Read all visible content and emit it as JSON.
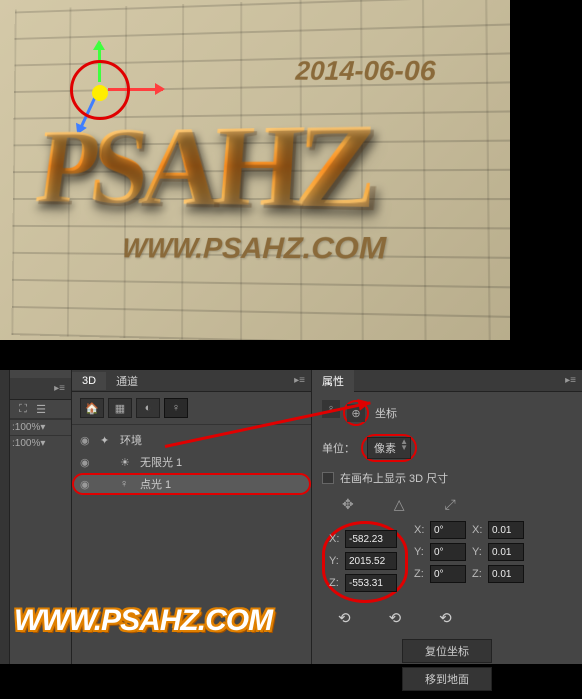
{
  "canvas": {
    "date_text": "2014-06-06",
    "main_text": "PSAHZ",
    "sub_text": "WWW.PSAHZ.COM"
  },
  "threed_panel": {
    "tab_3d": "3D",
    "tab_ch": "通道",
    "items": {
      "env": "环境",
      "infinite": "无限光 1",
      "point": "点光 1"
    }
  },
  "props_panel": {
    "title": "属性",
    "section": "坐标",
    "unit_label": "单位：",
    "unit_value": "像素",
    "show_3d": "在画布上显示 3D 尺寸",
    "coords": {
      "x_label": "X:",
      "x_val": "-582.23",
      "y_label": "Y:",
      "y_val": "2015.52",
      "z_label": "Z:",
      "z_val": "-553.31",
      "rot_x_label": "X:",
      "rot_x_val": "0°",
      "rot_y_label": "Y:",
      "rot_y_val": "0°",
      "rot_z_label": "Z:",
      "rot_z_val": "0°",
      "sx_label": "X:",
      "sx_val": "0.01",
      "sy_label": "Y:",
      "sy_val": "0.01",
      "sz_label": "Z:",
      "sz_val": "0.01"
    },
    "reset_btn": "复位坐标",
    "ground_btn": "移到地面"
  },
  "layers_mini": {
    "opacity": "100%"
  },
  "watermark": "WWW.PSAHZ.COM"
}
